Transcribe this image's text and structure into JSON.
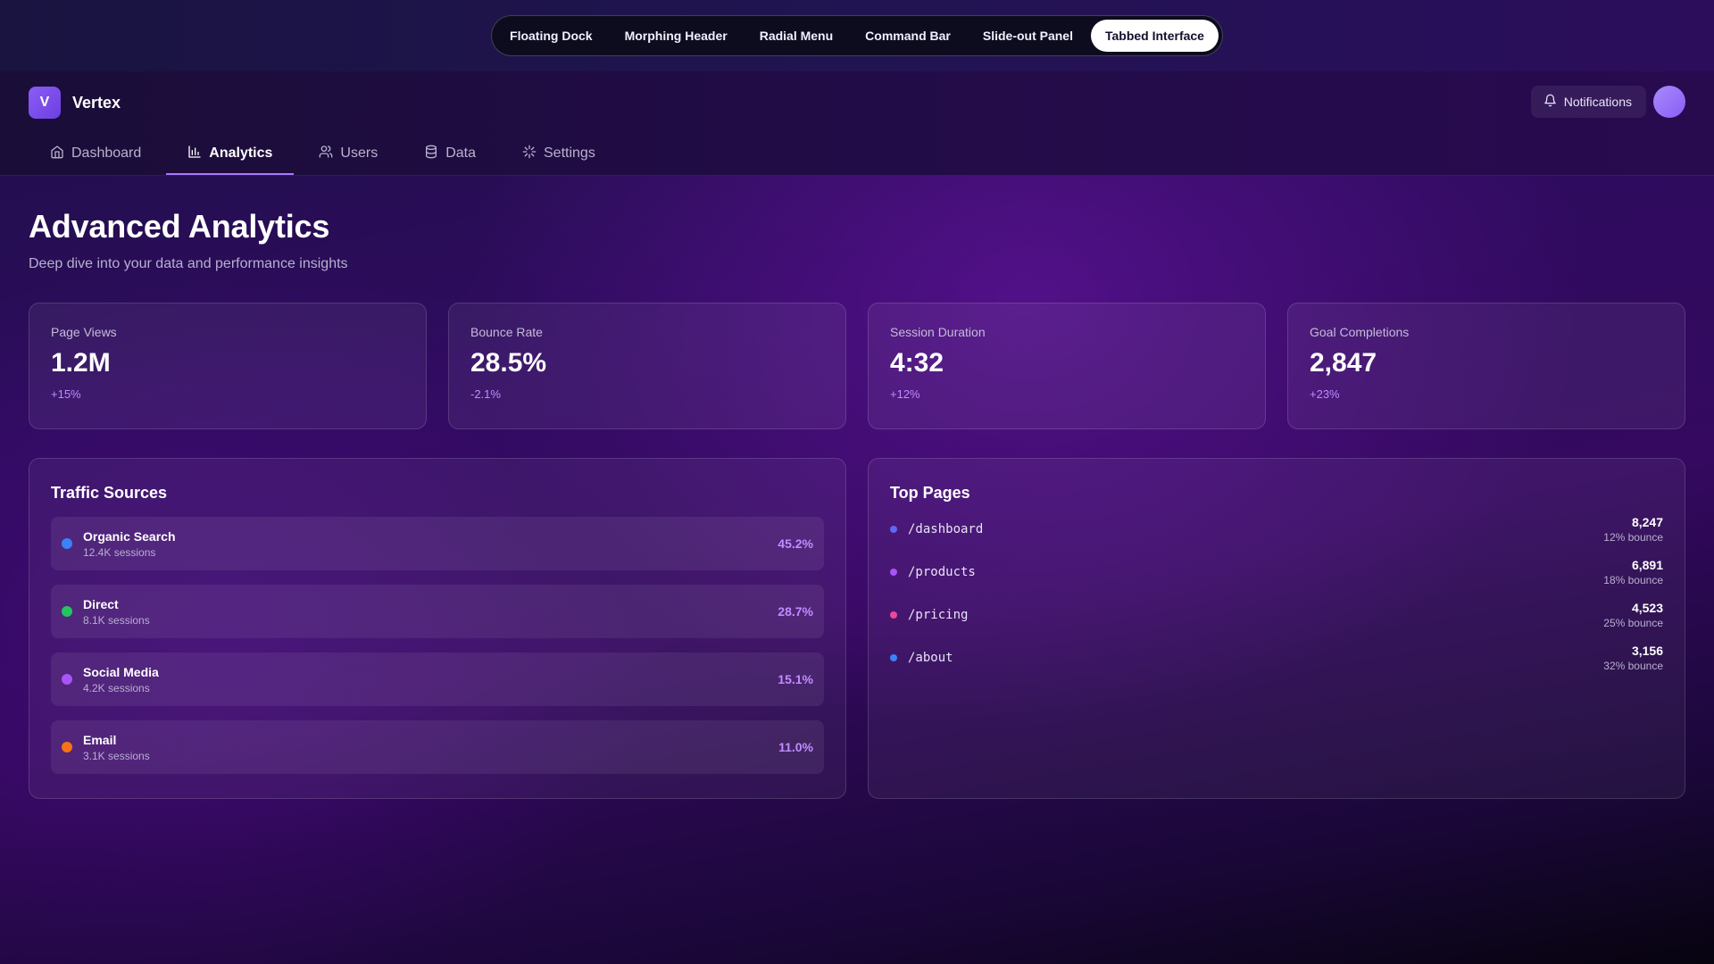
{
  "switcher": {
    "items": [
      {
        "label": "Floating Dock"
      },
      {
        "label": "Morphing Header"
      },
      {
        "label": "Radial Menu"
      },
      {
        "label": "Command Bar"
      },
      {
        "label": "Slide-out Panel"
      },
      {
        "label": "Tabbed Interface",
        "active": true
      }
    ]
  },
  "brand": {
    "logo_letter": "V",
    "name": "Vertex"
  },
  "header": {
    "notifications_label": "Notifications",
    "notifications_icon": "bell-icon"
  },
  "tabs": [
    {
      "label": "Dashboard",
      "icon": "home-icon"
    },
    {
      "label": "Analytics",
      "icon": "bar-chart-icon",
      "active": true
    },
    {
      "label": "Users",
      "icon": "users-icon"
    },
    {
      "label": "Data",
      "icon": "database-icon"
    },
    {
      "label": "Settings",
      "icon": "settings-icon"
    }
  ],
  "page": {
    "title": "Advanced Analytics",
    "subtitle": "Deep dive into your data and performance insights"
  },
  "stats": [
    {
      "label": "Page Views",
      "value": "1.2M",
      "change": "+15%"
    },
    {
      "label": "Bounce Rate",
      "value": "28.5%",
      "change": "-2.1%"
    },
    {
      "label": "Session Duration",
      "value": "4:32",
      "change": "+12%"
    },
    {
      "label": "Goal Completions",
      "value": "2,847",
      "change": "+23%"
    }
  ],
  "traffic": {
    "title": "Traffic Sources",
    "items": [
      {
        "name": "Organic Search",
        "sessions": "12.4K sessions",
        "percent": "45.2%",
        "color": "#3b82f6"
      },
      {
        "name": "Direct",
        "sessions": "8.1K sessions",
        "percent": "28.7%",
        "color": "#22c55e"
      },
      {
        "name": "Social Media",
        "sessions": "4.2K sessions",
        "percent": "15.1%",
        "color": "#a855f7"
      },
      {
        "name": "Email",
        "sessions": "3.1K sessions",
        "percent": "11.0%",
        "color": "#f97316"
      }
    ]
  },
  "top_pages": {
    "title": "Top Pages",
    "items": [
      {
        "path": "/dashboard",
        "views": "8,247",
        "bounce": "12% bounce",
        "color": "#6366f1"
      },
      {
        "path": "/products",
        "views": "6,891",
        "bounce": "18% bounce",
        "color": "#a855f7"
      },
      {
        "path": "/pricing",
        "views": "4,523",
        "bounce": "25% bounce",
        "color": "#ec4899"
      },
      {
        "path": "/about",
        "views": "3,156",
        "bounce": "32% bounce",
        "color": "#3b82f6"
      }
    ]
  },
  "colors": {
    "accent": "#a978ff",
    "change_text": "#c08cff"
  }
}
